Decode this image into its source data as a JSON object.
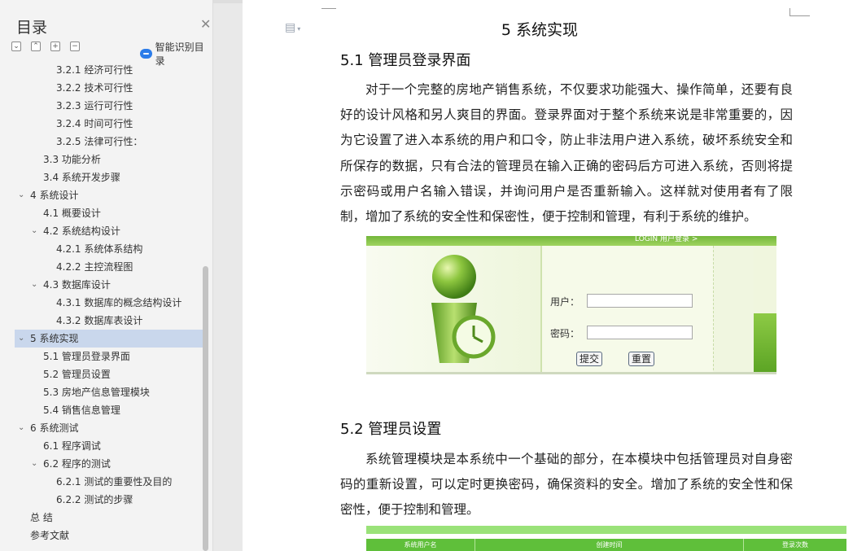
{
  "sidebar": {
    "title": "目录",
    "close_icon": "close-icon",
    "tools": [
      "collapse-all",
      "expand-up",
      "expand-plus",
      "collapse-minus"
    ],
    "smart_label": "智能识别目录",
    "items": [
      {
        "label": "3.2.1 经济可行性",
        "level": 3
      },
      {
        "label": "3.2.2 技术可行性",
        "level": 3
      },
      {
        "label": "3.2.3 运行可行性",
        "level": 3
      },
      {
        "label": "3.2.4 时间可行性",
        "level": 3
      },
      {
        "label": "3.2.5 法律可行性：",
        "level": 3
      },
      {
        "label": "3.3 功能分析",
        "level": 2
      },
      {
        "label": "3.4 系统开发步骤",
        "level": 2
      },
      {
        "label": "4 系统设计",
        "level": 1,
        "caret": true
      },
      {
        "label": "4.1 概要设计",
        "level": 2
      },
      {
        "label": "4.2 系统结构设计",
        "level": 2,
        "caret": true
      },
      {
        "label": "4.2.1 系统体系结构",
        "level": 3
      },
      {
        "label": "4.2.2 主控流程图",
        "level": 3
      },
      {
        "label": "4.3 数据库设计",
        "level": 2,
        "caret": true
      },
      {
        "label": "4.3.1 数据库的概念结构设计",
        "level": 3
      },
      {
        "label": "4.3.2 数据库表设计",
        "level": 3
      },
      {
        "label": "5 系统实现",
        "level": 1,
        "caret": true,
        "active": true
      },
      {
        "label": "5.1 管理员登录界面",
        "level": 2
      },
      {
        "label": "5.2 管理员设置",
        "level": 2
      },
      {
        "label": "5.3 房地产信息管理模块",
        "level": 2
      },
      {
        "label": "5.4 销售信息管理",
        "level": 2
      },
      {
        "label": "6 系统测试",
        "level": 1,
        "caret": true
      },
      {
        "label": "6.1  程序调试",
        "level": 2
      },
      {
        "label": "6.2  程序的测试",
        "level": 2,
        "caret": true
      },
      {
        "label": "6.2.1  测试的重要性及目的",
        "level": 3
      },
      {
        "label": "6.2.2  测试的步骤",
        "level": 3
      },
      {
        "label": "总  结",
        "level": 1
      },
      {
        "label": "参考文献",
        "level": 1
      }
    ]
  },
  "document": {
    "chapter_title": "5 系统实现",
    "section1_title": "5.1 管理员登录界面",
    "section1_para": "对于一个完整的房地产销售系统，不仅要求功能强大、操作简单，还要有良好的设计风格和另人爽目的界面。登录界面对于整个系统来说是非常重要的，因为它设置了进入本系统的用户和口令，防止非法用户进入系统，破坏系统安全和所保存的数据，只有合法的管理员在输入正确的密码后方可进入系统，否则将提示密码或用户名输入错误，并询问用户是否重新输入。这样就对使用者有了限制，增加了系统的安全性和保密性，便于控制和管理，有利于系统的维护。",
    "section2_title": "5.2 管理员设置",
    "section2_para": "系统管理模块是本系统中一个基础的部分，在本模块中包括管理员对自身密码的重新设置，可以定时更换密码，确保资料的安全。增加了系统的安全性和保密性，便于控制和管理。"
  },
  "login_figure": {
    "banner": "LOGIN 用户登录 >",
    "user_label": "用户：",
    "password_label": "密码：",
    "submit_label": "提交",
    "reset_label": "重置"
  },
  "admin_figure": {
    "columns": [
      "系统用户名",
      "创建时间",
      "登录次数"
    ]
  },
  "colors": {
    "sidebar_bg": "#f3f3f3",
    "active_item": "#c9d7ec",
    "login_green": "#73b63a",
    "table_green": "#5fbf3a",
    "smart_icon": "#2b7ce9"
  }
}
